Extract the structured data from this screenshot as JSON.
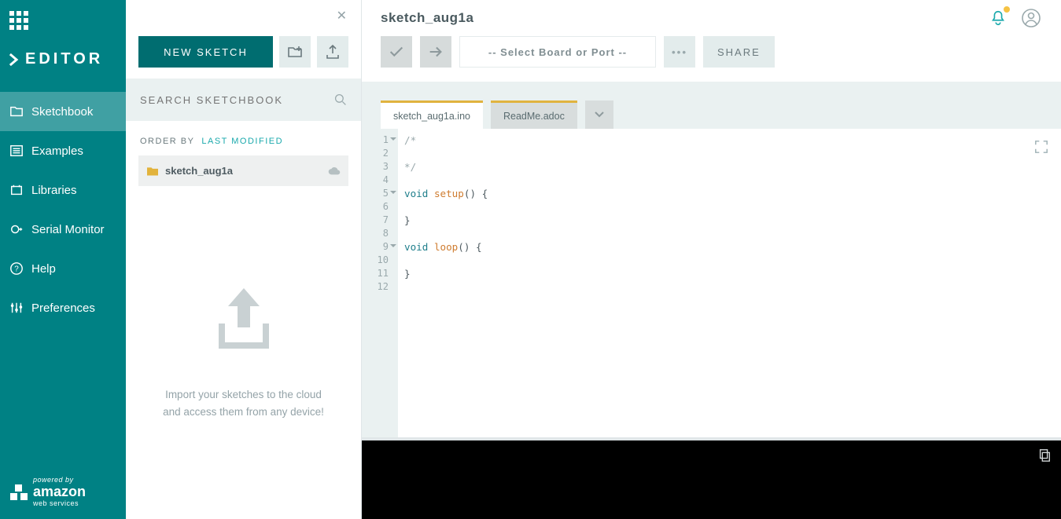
{
  "app_title": "EDITOR",
  "sidebar": {
    "items": [
      {
        "label": "Sketchbook"
      },
      {
        "label": "Examples"
      },
      {
        "label": "Libraries"
      },
      {
        "label": "Serial Monitor"
      },
      {
        "label": "Help"
      },
      {
        "label": "Preferences"
      }
    ],
    "aws_powered": "powered by",
    "aws_amazon": "amazon",
    "aws_ws": "web services"
  },
  "panel2": {
    "new_sketch": "NEW SKETCH",
    "search_placeholder": "SEARCH SKETCHBOOK",
    "orderby_label": "ORDER BY",
    "orderby_value": "LAST MODIFIED",
    "sketch_name": "sketch_aug1a",
    "import_text": "Import your sketches to the cloud and access them from any device!"
  },
  "main": {
    "sketch_title": "sketch_aug1a",
    "board_select": "-- Select Board or Port --",
    "share": "SHARE",
    "tabs": [
      {
        "label": "sketch_aug1a.ino"
      },
      {
        "label": "ReadMe.adoc"
      }
    ],
    "code": {
      "l1": "/*",
      "l2": "",
      "l3": "*/",
      "l4": "",
      "l5_kw": "void",
      "l5_fn": "setup",
      "l5_tail": "() {",
      "l6": "    ",
      "l7": "}",
      "l8": "",
      "l9_kw": "void",
      "l9_fn": "loop",
      "l9_tail": "() {",
      "l10": "    ",
      "l11": "}",
      "l12": ""
    }
  }
}
